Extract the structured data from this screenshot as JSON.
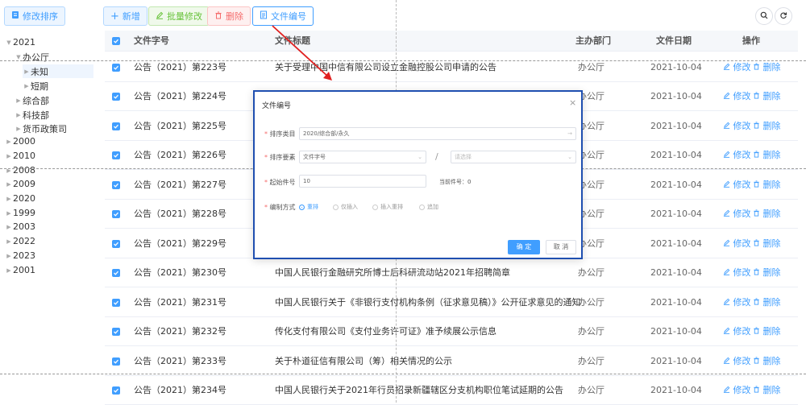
{
  "toolbar": {
    "sort_label": "修改排序",
    "add_label": "新增",
    "batch_label": "批量修改",
    "delete_label": "删除",
    "docno_label": "文件编号"
  },
  "tree": {
    "y2021": "2021",
    "office": "办公厅",
    "unknown": "未知",
    "shortterm": "短期",
    "general": "综合部",
    "tech": "科技部",
    "monetary": "货币政策司",
    "others": [
      "2000",
      "2010",
      "2008",
      "2009",
      "2020",
      "1999",
      "2003",
      "2022",
      "2023",
      "2001"
    ]
  },
  "table": {
    "headers": {
      "docno": "文件字号",
      "title": "文件标题",
      "dept": "主办部门",
      "date": "文件日期",
      "ops": "操作"
    },
    "edit_label": "修改",
    "delete_label": "删除",
    "rows": [
      {
        "docno": "公告（2021）第223号",
        "title": "关于受理中国中信有限公司设立金融控股公司申请的公告",
        "dept": "办公厅",
        "date": "2021-10-04"
      },
      {
        "docno": "公告（2021）第224号",
        "title": "",
        "dept": "办公厅",
        "date": "2021-10-04"
      },
      {
        "docno": "公告（2021）第225号",
        "title": "",
        "dept": "办公厅",
        "date": "2021-10-04"
      },
      {
        "docno": "公告（2021）第226号",
        "title": "",
        "dept": "办公厅",
        "date": "2021-10-04"
      },
      {
        "docno": "公告（2021）第227号",
        "title": "",
        "dept": "办公厅",
        "date": "2021-10-04"
      },
      {
        "docno": "公告（2021）第228号",
        "title": "",
        "dept": "办公厅",
        "date": "2021-10-04"
      },
      {
        "docno": "公告（2021）第229号",
        "title": "",
        "dept": "办公厅",
        "date": "2021-10-04"
      },
      {
        "docno": "公告（2021）第230号",
        "title": "中国人民银行金融研究所博士后科研流动站2021年招聘简章",
        "dept": "办公厅",
        "date": "2021-10-04"
      },
      {
        "docno": "公告（2021）第231号",
        "title": "中国人民银行关于《非银行支付机构条例（征求意见稿）》公开征求意见的通知",
        "dept": "办公厅",
        "date": "2021-10-04"
      },
      {
        "docno": "公告（2021）第232号",
        "title": "传化支付有限公司《支付业务许可证》准予续展公示信息",
        "dept": "办公厅",
        "date": "2021-10-04"
      },
      {
        "docno": "公告（2021）第233号",
        "title": "关于朴道征信有限公司（筹）相关情况的公示",
        "dept": "办公厅",
        "date": "2021-10-04"
      },
      {
        "docno": "公告（2021）第234号",
        "title": "中国人民银行关于2021年行员招录新疆辖区分支机构职位笔试延期的公告",
        "dept": "办公厅",
        "date": "2021-10-04"
      }
    ]
  },
  "modal": {
    "title": "文件编号",
    "close": "×",
    "category_label": "排序类目",
    "category_value": "2020/综合部/永久",
    "category_arrow": "→",
    "element_label": "排序要素",
    "element_value": "文件字号",
    "separator": "/",
    "element_placeholder": "请选择",
    "start_label": "起始件号",
    "start_value": "10",
    "current_label": "当前件号：",
    "current_value": "0",
    "mode_label": "编制方式",
    "modes": [
      "重排",
      "仅插入",
      "插入重排",
      "追加"
    ],
    "ok_label": "确 定",
    "cancel_label": "取 消"
  },
  "colors": {
    "primary": "#409eff",
    "success": "#67c23a",
    "danger": "#f56c6c",
    "annotation": "#e02020",
    "modal_border": "#1f4fb0"
  }
}
